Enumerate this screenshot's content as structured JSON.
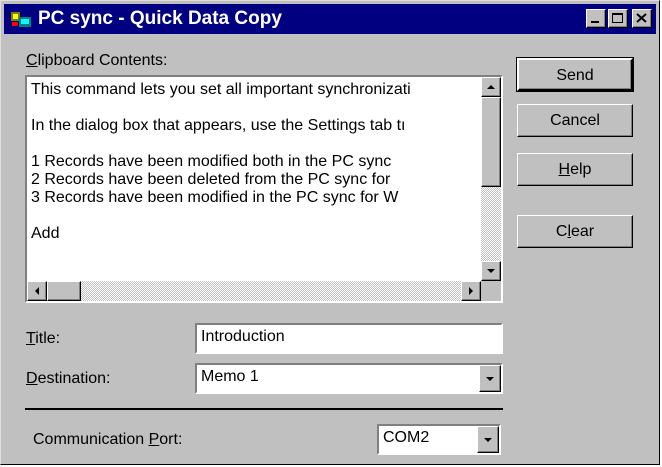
{
  "window": {
    "title": "PC sync - Quick Data Copy",
    "controls": [
      "minimize-icon",
      "maximize-icon",
      "close-icon"
    ]
  },
  "clipboard": {
    "label_prefix": "",
    "label_mnemonic": "C",
    "label_rest": "lipboard Contents:",
    "lines": [
      "This command lets you set all important synchronizati",
      "",
      "In the dialog box that appears, use the Settings tab tı",
      "",
      "1   Records have been modified both in the PC sync",
      "2   Records have been deleted from the PC sync for",
      "3   Records have been modified in the PC sync for W",
      "",
      "Add"
    ]
  },
  "title_field": {
    "label_mnemonic": "T",
    "label_rest": "itle:",
    "value": "Introduction"
  },
  "destination": {
    "label_mnemonic": "D",
    "label_rest": "estination:",
    "value": "Memo 1"
  },
  "port": {
    "label_prefix": "Communication ",
    "label_mnemonic": "P",
    "label_rest": "ort:",
    "value": "COM2"
  },
  "buttons": {
    "send": "Send",
    "cancel": "Cancel",
    "help_mnemonic": "H",
    "help_rest": "elp",
    "clear_prefix": "C",
    "clear_mnemonic": "l",
    "clear_rest": "ear"
  },
  "colors": {
    "titlebar": "#000080",
    "face": "#c0c0c0"
  }
}
